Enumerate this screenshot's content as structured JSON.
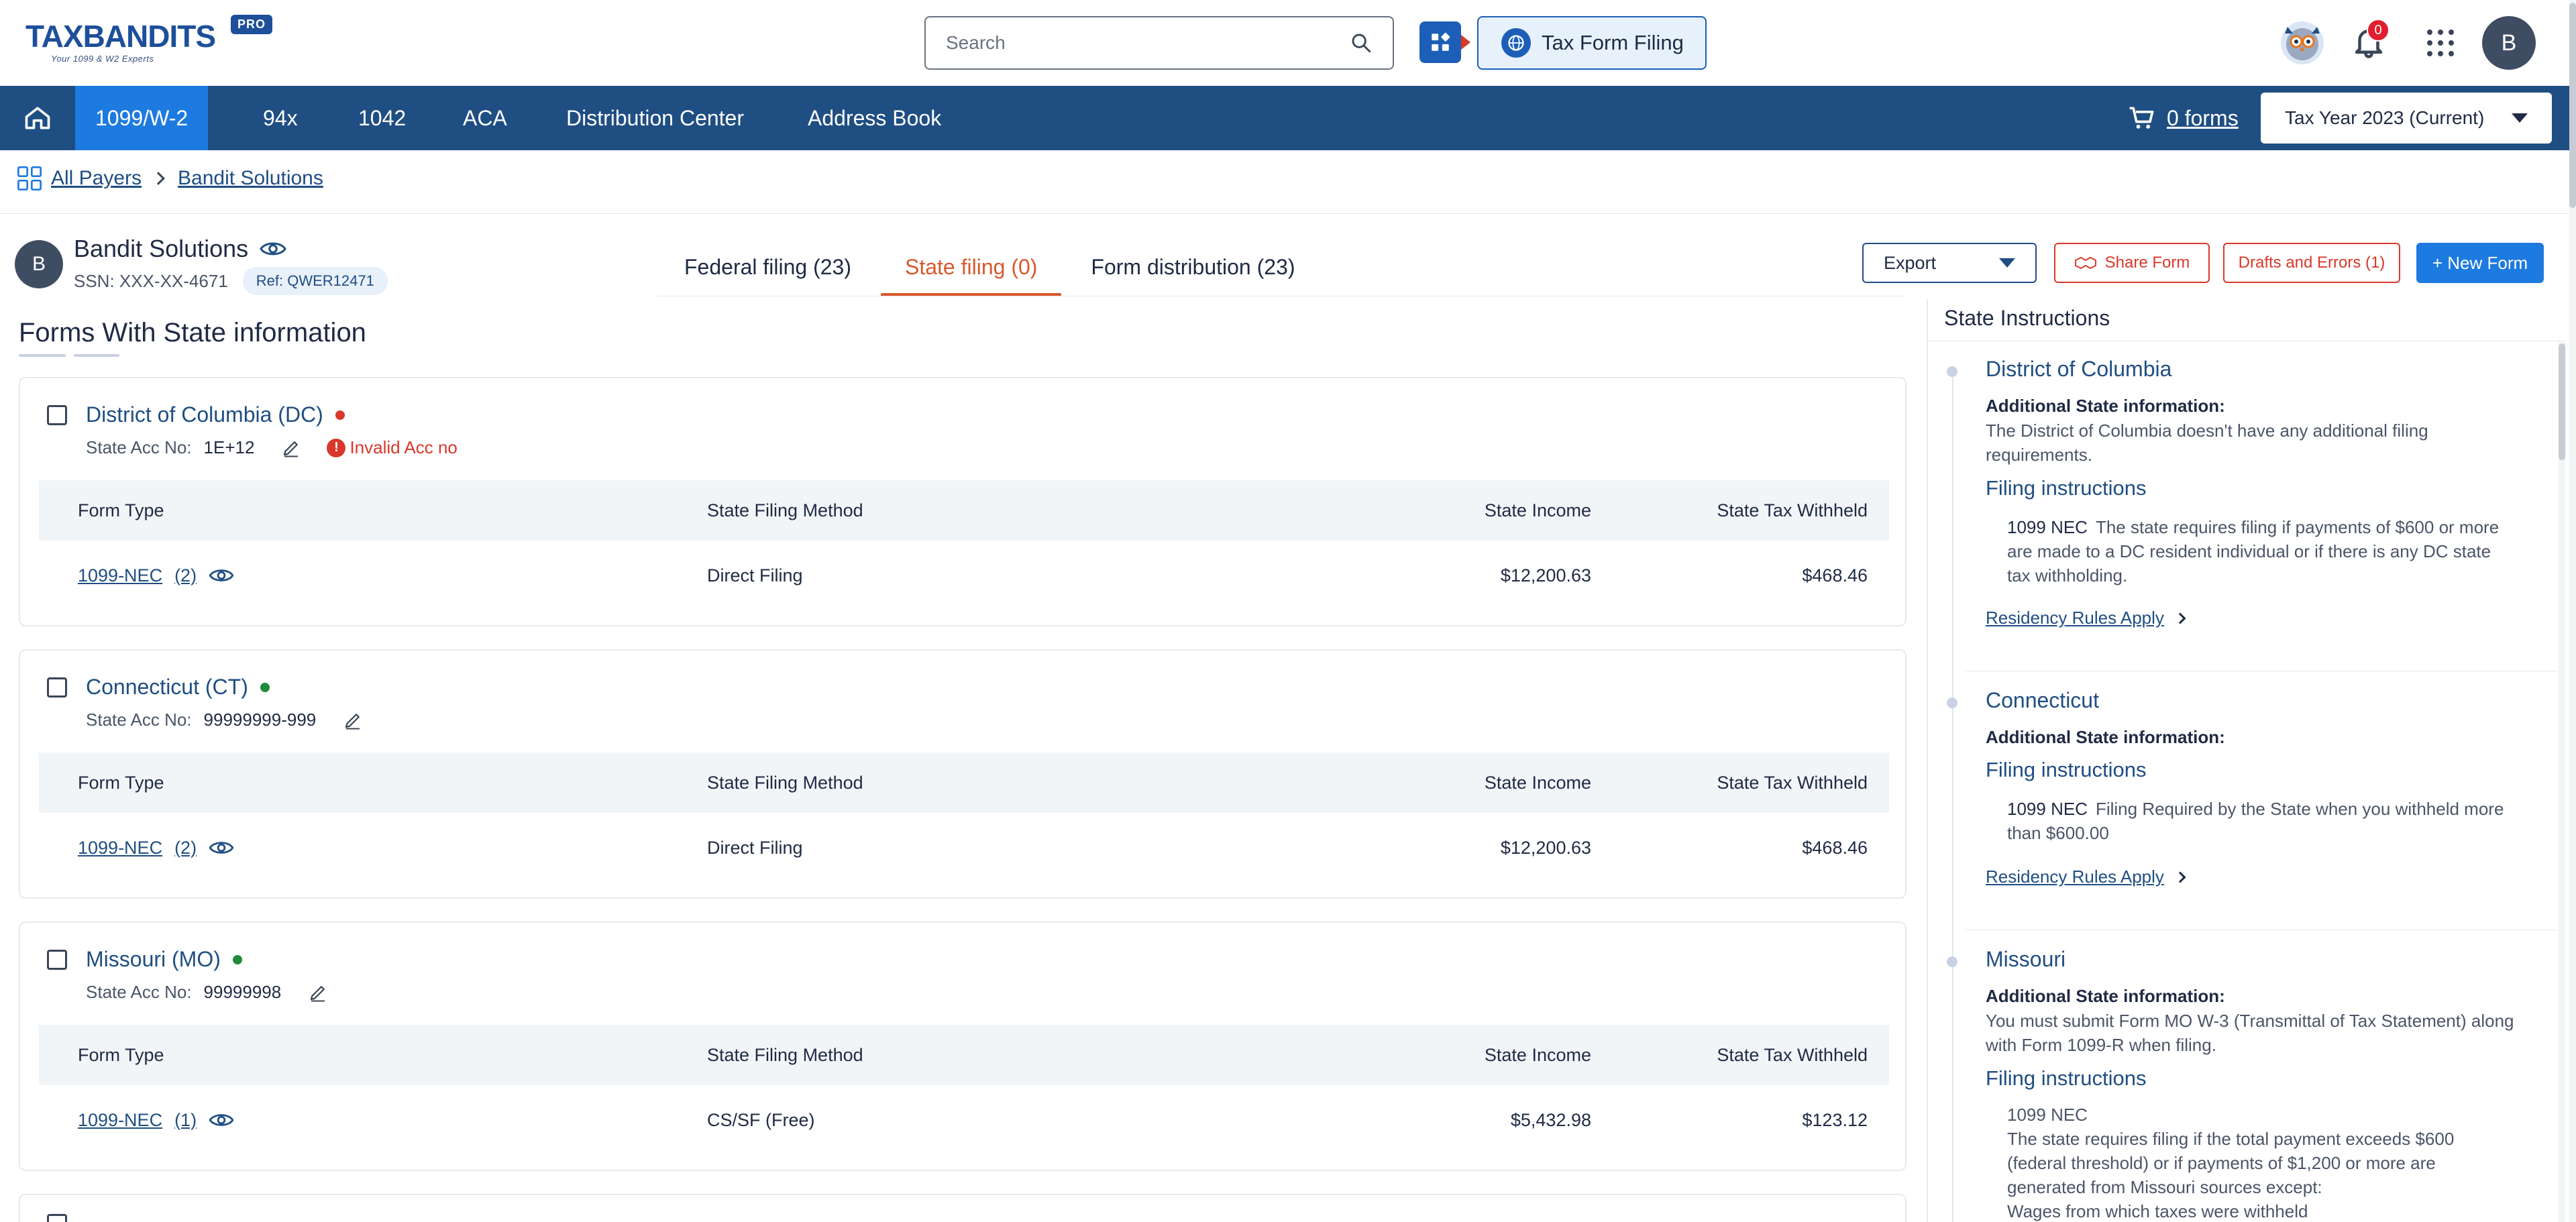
{
  "header": {
    "logo_text": "TAXBANDITS",
    "logo_tagline": "Your 1099 & W2 Experts",
    "pro_badge": "PRO",
    "search_placeholder": "Search",
    "tax_form_filing_label": "Tax Form Filing",
    "notification_count": "0",
    "avatar_initial": "B"
  },
  "nav": {
    "items": [
      {
        "label": "1099/W-2",
        "active": true
      },
      {
        "label": "94x"
      },
      {
        "label": "1042"
      },
      {
        "label": "ACA"
      },
      {
        "label": "Distribution Center"
      },
      {
        "label": "Address Book"
      }
    ],
    "cart_label": "0 forms",
    "tax_year": "Tax Year 2023 (Current)"
  },
  "breadcrumb": {
    "all_payers": "All Payers",
    "current": "Bandit Solutions"
  },
  "payer": {
    "initial": "B",
    "name": "Bandit Solutions",
    "ssn": "SSN: XXX-XX-4671",
    "ref": "Ref: QWER12471"
  },
  "tabs": [
    {
      "label": "Federal filing (23)"
    },
    {
      "label": "State filing (0)",
      "active": true
    },
    {
      "label": "Form distribution (23)"
    }
  ],
  "actions": {
    "export_label": "Export",
    "share_label": "Share Form",
    "drafts_label": "Drafts and Errors (1)",
    "new_form_label": "+ New Form"
  },
  "main": {
    "section_title": "Forms With State information",
    "columns": {
      "form_type": "Form Type",
      "method": "State Filing Method",
      "income": "State Income",
      "withheld": "State Tax Withheld"
    },
    "acc_label": "State Acc No:",
    "states": [
      {
        "name": "District of Columbia (DC)",
        "status_color": "#d9382b",
        "acc_no": "1E+12",
        "error": "Invalid Acc no",
        "row": {
          "form": "1099-NEC",
          "count": "(2)",
          "method": "Direct Filing",
          "income": "$12,200.63",
          "withheld": "$468.46"
        }
      },
      {
        "name": "Connecticut (CT)",
        "status_color": "#1e8a3c",
        "acc_no": "99999999-999",
        "error": "",
        "row": {
          "form": "1099-NEC",
          "count": "(2)",
          "method": "Direct Filing",
          "income": "$12,200.63",
          "withheld": "$468.46"
        }
      },
      {
        "name": "Missouri (MO)",
        "status_color": "#1e8a3c",
        "acc_no": "99999998",
        "error": "",
        "row": {
          "form": "1099-NEC",
          "count": "(1)",
          "method": "CS/SF (Free)",
          "income": "$5,432.98",
          "withheld": "$123.12"
        }
      }
    ]
  },
  "instructions": {
    "title": "State Instructions",
    "additional_label": "Additional State information:",
    "filing_label": "Filing instructions",
    "residency_label": "Residency Rules Apply",
    "blocks": [
      {
        "state": "District of Columbia",
        "additional": "The District of Columbia doesn't have any additional filing requirements.",
        "form": "1099 NEC",
        "filing": "The state requires filing if payments of $600 or more are made to a DC resident individual or if there is any DC state tax withholding."
      },
      {
        "state": "Connecticut",
        "additional": "",
        "form": "1099 NEC",
        "filing": "Filing Required by the State when you withheld more than $600.00"
      },
      {
        "state": "Missouri",
        "additional": "You must submit Form MO W-3 (Transmittal of Tax Statement) along with Form 1099-R when filing.",
        "form": "1099 NEC",
        "filing": "The state requires filing if the total payment exceeds $600 (federal threshold) or if payments of $1,200 or more are generated from Missouri sources except:",
        "filing_extra": "Wages from which taxes were withheld"
      }
    ]
  }
}
